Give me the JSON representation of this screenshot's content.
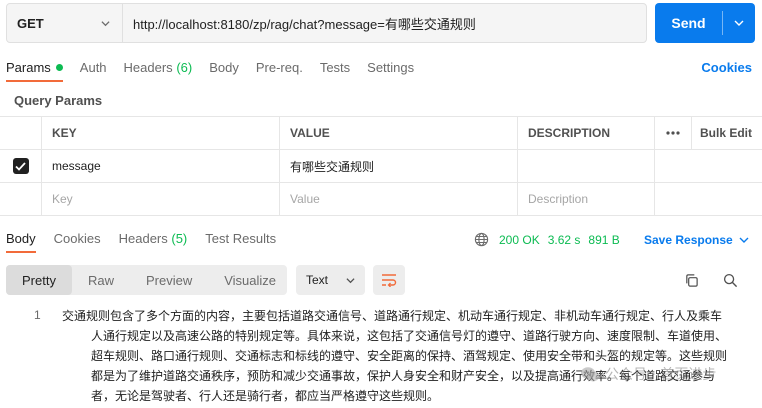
{
  "request": {
    "method": "GET",
    "url": "http://localhost:8180/zp/rag/chat?message=有哪些交通规则",
    "send_label": "Send"
  },
  "request_tabs": [
    {
      "label": "Params"
    },
    {
      "label": "Auth"
    },
    {
      "label": "Headers",
      "count": "(6)"
    },
    {
      "label": "Body"
    },
    {
      "label": "Pre-req."
    },
    {
      "label": "Tests"
    },
    {
      "label": "Settings"
    }
  ],
  "cookies_label": "Cookies",
  "query_params": {
    "title": "Query Params",
    "headers": [
      "KEY",
      "VALUE",
      "DESCRIPTION",
      "ooo",
      "Bulk Edit"
    ],
    "rows": [
      {
        "key": "message",
        "value": "有哪些交通规则",
        "description": ""
      }
    ],
    "placeholder": {
      "key": "Key",
      "value": "Value",
      "description": "Description"
    }
  },
  "response_tabs": [
    {
      "label": "Body"
    },
    {
      "label": "Cookies"
    },
    {
      "label": "Headers",
      "count": "(5)"
    },
    {
      "label": "Test Results"
    }
  ],
  "response_meta": {
    "status": "200 OK",
    "time": "3.62 s",
    "size": "891 B",
    "save_label": "Save Response"
  },
  "format_options": [
    "Pretty",
    "Raw",
    "Preview",
    "Visualize"
  ],
  "text_format": "Text",
  "body": {
    "line_number": "1",
    "lines": [
      "交通规则包含了多个方面的内容，主要包括道路交通信号、道路通行规定、机动车通行规定、非机动车通行规定、行人及乘车",
      "人通行规定以及高速公路的特别规定等。具体来说，这包括了交通信号灯的遵守、道路行驶方向、速度限制、车道使用、",
      "超车规则、路口通行规则、交通标志和标线的遵守、安全距离的保持、酒驾规定、使用安全带和头盔的规定等。这些规则",
      "都是为了维护道路交通秩序，预防和减少交通事故，保护人身安全和财产安全，以及提高通行效率。每个道路交通参与",
      "者，无论是驾驶者、行人还是骑行者，都应当严格遵守这些规则。"
    ]
  },
  "watermark": "公众号 · 首页进步",
  "colors": {
    "accent": "#097bed",
    "active_tab": "#f26b3a",
    "success": "#0cbb52"
  }
}
